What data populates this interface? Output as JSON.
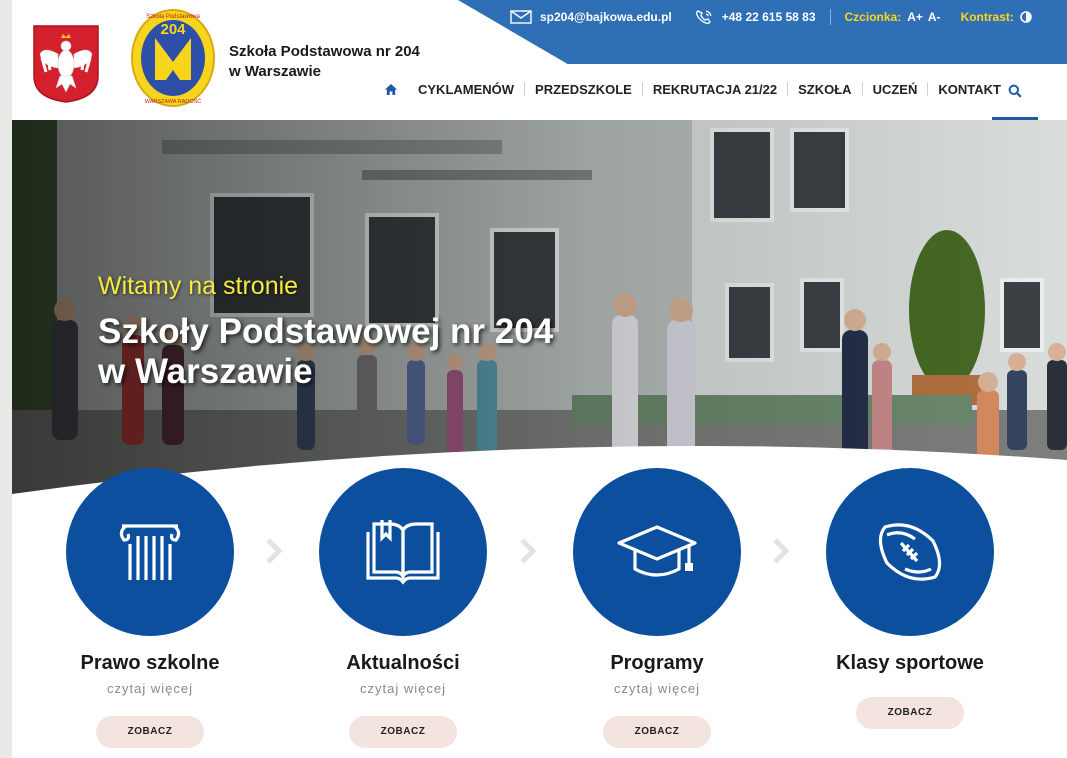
{
  "header": {
    "school_name_line1": "Szkoła Podstawowa nr 204",
    "school_name_line2": "w Warszawie",
    "badge_number": "204",
    "badge_top_text": "Szkoła Podstawowa",
    "badge_bottom_text": "WARSZAWA RADOŚĆ"
  },
  "topbar": {
    "email": "sp204@bajkowa.edu.pl",
    "phone": "+48 22 615 58 83",
    "font_label": "Czcionka:",
    "font_increase": "A+",
    "font_decrease": "A-",
    "contrast_label": "Kontrast:",
    "email_icon": "envelope-icon",
    "phone_icon": "phone-icon",
    "contrast_icon": "contrast-icon",
    "bar_color": "#2e6fb5",
    "accent_color": "#ffd51c"
  },
  "nav": {
    "home_icon": "home-icon",
    "items": [
      "CYKLAMENÓW",
      "PRZEDSZKOLE",
      "REKRUTACJA 21/22",
      "SZKOŁA",
      "UCZEŃ",
      "KONTAKT"
    ],
    "search_icon": "search-icon"
  },
  "hero": {
    "subtitle": "Witamy na stronie",
    "title_line1": "Szkoły Podstawowej nr 204",
    "title_line2": "w Warszawie"
  },
  "cards": [
    {
      "title": "Prawo szkolne",
      "subtitle": "czytaj więcej",
      "button": "ZOBACZ",
      "icon": "column-icon"
    },
    {
      "title": "Aktualności",
      "subtitle": "czytaj więcej",
      "button": "ZOBACZ",
      "icon": "book-icon"
    },
    {
      "title": "Programy",
      "subtitle": "czytaj więcej",
      "button": "ZOBACZ",
      "icon": "graduation-cap-icon"
    },
    {
      "title": "Klasy sportowe",
      "subtitle": "",
      "button": "ZOBACZ",
      "icon": "football-icon"
    }
  ],
  "colors": {
    "circle_blue": "#0d4f9f",
    "button_bg": "#f3e4e0"
  }
}
